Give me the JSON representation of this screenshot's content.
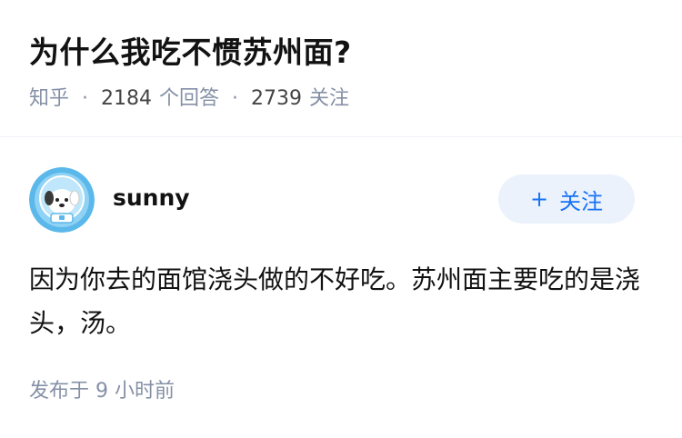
{
  "question": {
    "title": "为什么我吃不惯苏州面?",
    "source": "知乎",
    "answers_count": "2184",
    "answers_label": "个回答",
    "followers_count": "2739",
    "followers_label": "关注"
  },
  "answer": {
    "author": "sunny",
    "follow_button": "关注",
    "content": "因为你去的面馆浇头做的不好吃。苏州面主要吃的是浇头，汤。",
    "published": "发布于 9 小时前"
  },
  "colors": {
    "accent": "#1772f6",
    "button_bg": "#ebf2fc",
    "meta_text": "#8590a6"
  }
}
